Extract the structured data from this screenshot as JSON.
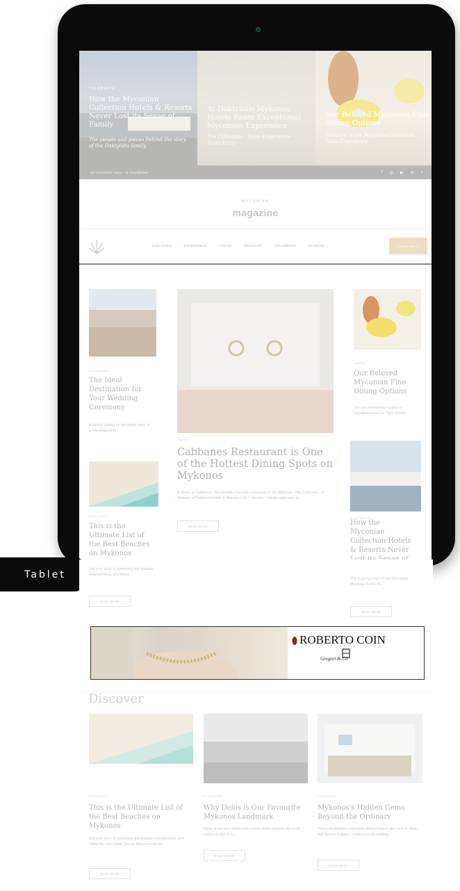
{
  "hero": {
    "panels": [
      {
        "tag": "CELEBRATE",
        "title": "How the Myconian Collection Hotels & Resorts Never Lost its Sense of Family",
        "subtitle": "The people and pieces behind the story of the Daktylidis family"
      },
      {
        "tag": "",
        "title": "At Daktylidis Mykonos Hotels Roam Exceptional Myconian Experience",
        "subtitle": "The Collection · Team Experience · Team Story"
      },
      {
        "tag": "",
        "title": "Our Beloved Myconian Fine Dining Options",
        "subtitle": "Pleasure in the Myconian Collection · Team Experience"
      }
    ],
    "footer_left": "28 JANUARY 2024  ·  ● TRENDING",
    "footer_icons": [
      "f",
      "◎",
      "▶",
      "✉",
      "⌕"
    ]
  },
  "masthead": {
    "brand_top": "MYCONIAN",
    "brand_main": "magazine"
  },
  "nav": {
    "items": [
      "DISCOVER",
      "EXPERIENCE",
      "TASTE",
      "RECOVER",
      "CELEBRATE",
      "STORIES ⌄"
    ],
    "cta": "CHECK RATES"
  },
  "articles": {
    "a1": {
      "meta": "CELEBRATE",
      "title": "The Ideal Destination for Your Wedding Ceremony",
      "excerpt": "A perfect setting for the stride down of a new beginning..."
    },
    "a2": {
      "meta": "TASTE",
      "title": "Cabbanes Restaurant is One of the Hottest Dining Spots on Mykonos",
      "excerpt": "A dinner at Cabbanes, the poolside 2-la-carte restaurant of the Myconian Villa Collection – a Member of Preferred Hotels & Resorts, LVX Collection – brings spice and all...",
      "button": "READ MORE"
    },
    "a3": {
      "meta": "TASTE",
      "title": "Our Beloved Myconian Fine Dining Options",
      "excerpt": "The uncompromised quality of ingredients and our \"farm to fork\"..."
    },
    "a4": {
      "meta": "DISCOVER",
      "title": "This is the Ultimate List of the Best Beaches on Mykonos",
      "excerpt": "Get your dose of swimming and seaside entertainment, and follow...",
      "button": "READ MORE"
    },
    "a5": {
      "meta": "CELEBRATE",
      "title": "How the Myconian Collection Hotels & Resorts Never Lost its Sense of Family",
      "excerpt": "The inspiring story of how the native Myconian family of...",
      "button": "READ MORE"
    }
  },
  "tablet_label": "Tablet",
  "ad": {
    "brand": "ROBERTO COIN",
    "sub": "Gregori & Co"
  },
  "discover": {
    "heading": "Discover",
    "cards": [
      {
        "meta": "DISCOVER",
        "title": "This is the Ultimate List of the Best Beaches on Mykonos",
        "excerpt": "Get your dose of swimming and seaside entertainment, and follow the vast Greek Sea as Mykonos can be...",
        "button": "READ MORE"
      },
      {
        "meta": "DISCOVER",
        "title": "Why Delos is Our Favourite Mykonos Landmark",
        "excerpt": "Delos is the only island in the world whose ancient city is not buried as part of a...",
        "button": "READ MORE"
      },
      {
        "meta": "DISCOVER",
        "title": "Mykonos's Hidden Gems Beyond the Ordinary",
        "excerpt": "These destinations and spots off from travel sites sure to show that forever hotspot... make your life exciting...",
        "button": "READ MORE"
      }
    ]
  },
  "colors": {
    "cta": "#f0dcc2",
    "device": "#0b0b0b"
  }
}
